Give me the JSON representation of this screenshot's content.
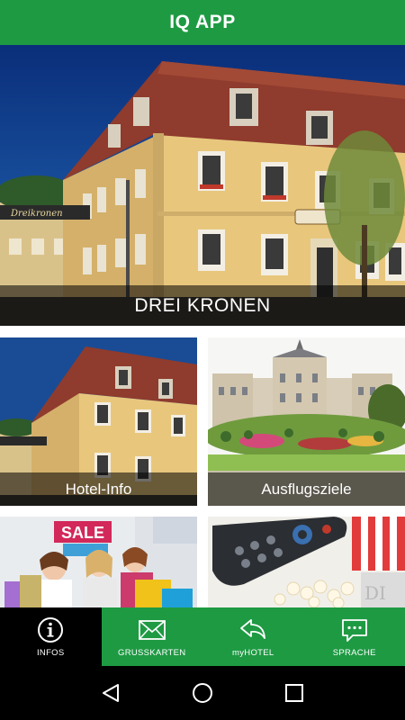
{
  "app": {
    "title": "IQ APP"
  },
  "hero": {
    "caption": "DREI KRONEN",
    "sign_text": "Dreikronen"
  },
  "tiles": [
    {
      "label": "Hotel-Info"
    },
    {
      "label": "Ausflugsziele"
    },
    {
      "label": "",
      "sign": "SALE"
    },
    {
      "label": ""
    }
  ],
  "tabbar": {
    "active": "infos",
    "items": [
      {
        "id": "infos",
        "label": "INFOS",
        "icon": "info-icon"
      },
      {
        "id": "grusskarten",
        "label": "GRUSSKARTEN",
        "icon": "envelope-icon"
      },
      {
        "id": "myhotel",
        "label": "myHOTEL",
        "icon": "reply-arrow-icon"
      },
      {
        "id": "sprache",
        "label": "SPRACHE",
        "icon": "speech-bubble-icon"
      }
    ]
  },
  "colors": {
    "brand_green": "#1e9a43",
    "active_tab": "#000000"
  },
  "navbar": [
    "back-icon",
    "home-icon",
    "recents-icon"
  ]
}
